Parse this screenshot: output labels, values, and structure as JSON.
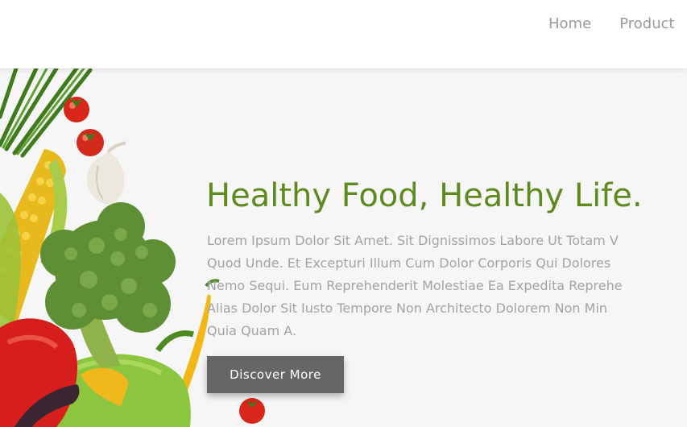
{
  "nav": {
    "items": [
      {
        "label": "Home"
      },
      {
        "label": "Product"
      }
    ]
  },
  "hero": {
    "title": "Healthy Food, Healthy Life.",
    "body_lines": [
      "Lorem Ipsum Dolor Sit Amet. Sit Dignissimos Labore Ut Totam V",
      "Quod Unde. Et Excepturi Illum Cum Dolor Corporis Qui Dolores",
      "Nemo Sequi. Eum Reprehenderit Molestiae Ea Expedita Reprehe",
      "Alias Dolor Sit Iusto Tempore Non Architecto Dolorem Non Min",
      "Quia Quam A."
    ],
    "cta_label": "Discover More"
  },
  "colors": {
    "title": "#5e8a1f",
    "nav_text": "#9a9a9a",
    "body_text": "#a3a3a3",
    "button": "#666666"
  },
  "icons": [
    "vegetables-image"
  ]
}
